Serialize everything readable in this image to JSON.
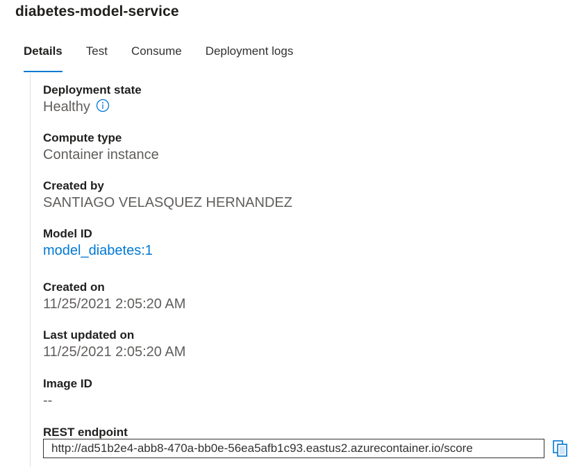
{
  "title": "diabetes-model-service",
  "tabs": [
    {
      "label": "Details",
      "active": true
    },
    {
      "label": "Test",
      "active": false
    },
    {
      "label": "Consume",
      "active": false
    },
    {
      "label": "Deployment logs",
      "active": false
    }
  ],
  "details": {
    "deployment_state": {
      "label": "Deployment state",
      "value": "Healthy",
      "icon": "info-icon"
    },
    "compute_type": {
      "label": "Compute type",
      "value": "Container instance"
    },
    "created_by": {
      "label": "Created by",
      "value": "SANTIAGO VELASQUEZ HERNANDEZ"
    },
    "model_id": {
      "label": "Model ID",
      "value": "model_diabetes:1"
    },
    "created_on": {
      "label": "Created on",
      "value": "11/25/2021 2:05:20 AM"
    },
    "last_updated_on": {
      "label": "Last updated on",
      "value": "11/25/2021 2:05:20 AM"
    },
    "image_id": {
      "label": "Image ID",
      "value": "--"
    },
    "rest_endpoint": {
      "label": "REST endpoint",
      "value": "http://ad51b2e4-abb8-470a-bb0e-56ea5afb1c93.eastus2.azurecontainer.io/score",
      "copy_icon": "copy-icon"
    }
  },
  "colors": {
    "accent": "#0078d4",
    "text_primary": "#201f1e",
    "text_secondary": "#605e5c"
  }
}
